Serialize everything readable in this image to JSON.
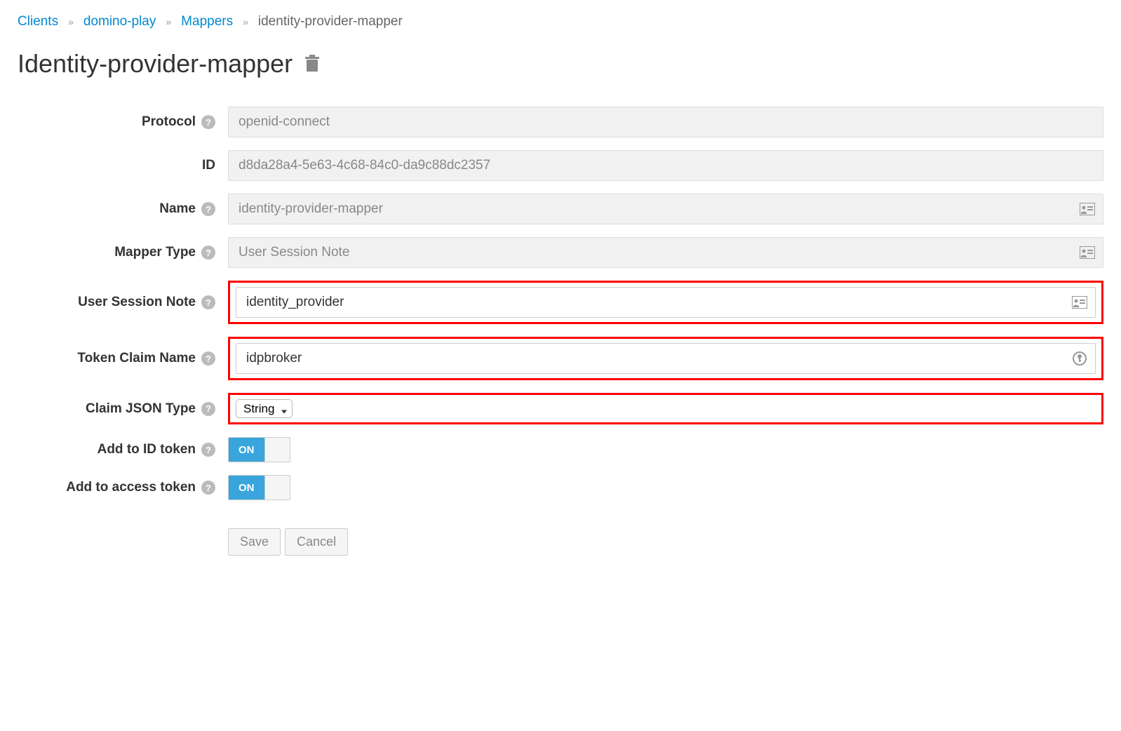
{
  "breadcrumb": {
    "items": [
      "Clients",
      "domino-play",
      "Mappers"
    ],
    "current": "identity-provider-mapper"
  },
  "page_title": "Identity-provider-mapper",
  "form": {
    "protocol": {
      "label": "Protocol",
      "value": "openid-connect"
    },
    "id": {
      "label": "ID",
      "value": "d8da28a4-5e63-4c68-84c0-da9c88dc2357"
    },
    "name": {
      "label": "Name",
      "value": "identity-provider-mapper"
    },
    "mapper_type": {
      "label": "Mapper Type",
      "value": "User Session Note"
    },
    "user_session_note": {
      "label": "User Session Note",
      "value": "identity_provider"
    },
    "token_claim_name": {
      "label": "Token Claim Name",
      "value": "idpbroker"
    },
    "claim_json_type": {
      "label": "Claim JSON Type",
      "value": "String"
    },
    "add_to_id_token": {
      "label": "Add to ID token",
      "value": "ON"
    },
    "add_to_access_token": {
      "label": "Add to access token",
      "value": "ON"
    }
  },
  "buttons": {
    "save": "Save",
    "cancel": "Cancel"
  }
}
